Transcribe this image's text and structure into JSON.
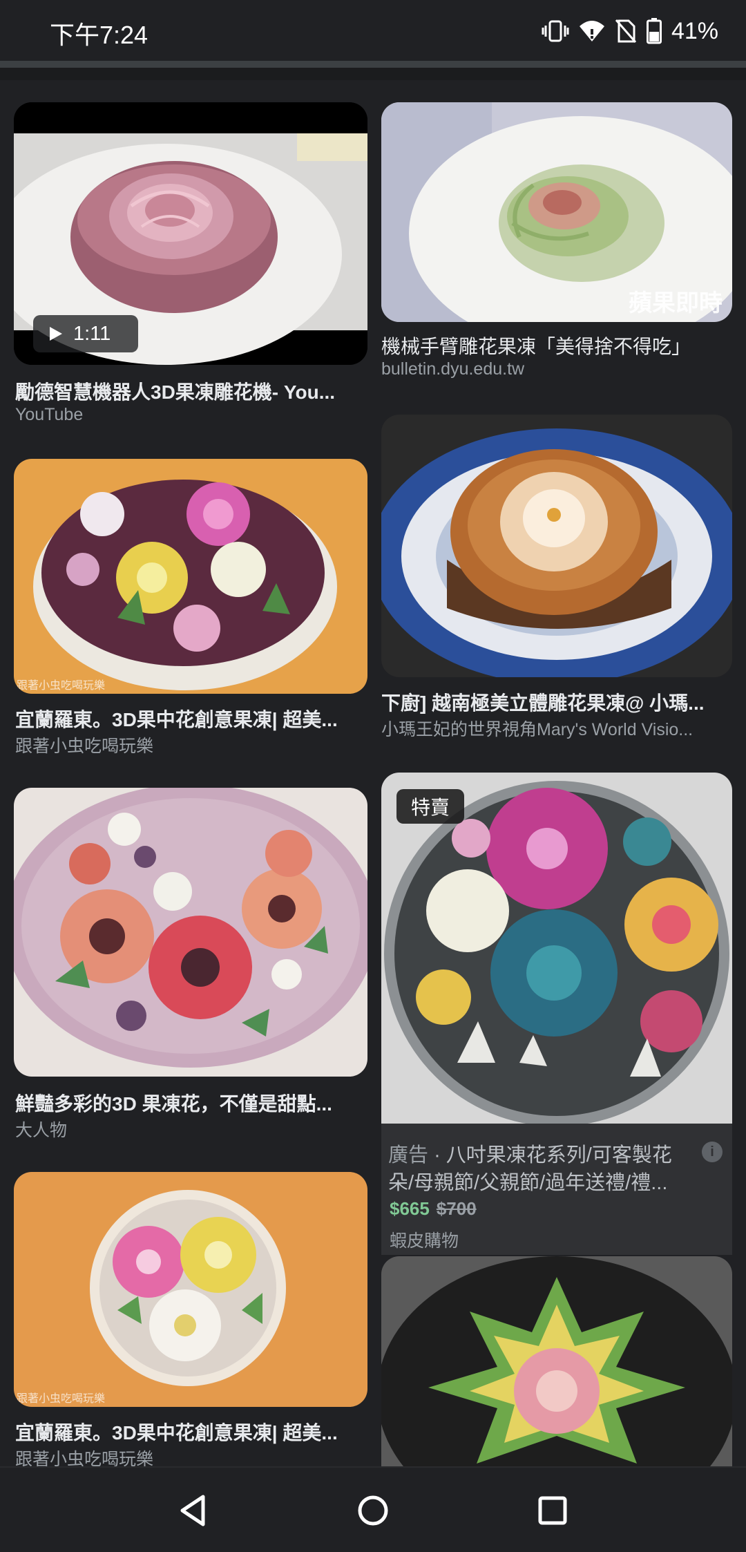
{
  "status_bar": {
    "time": "下午7:24",
    "battery": "41%"
  },
  "results": [
    {
      "title": "勵德智慧機器人3D果凍雕花機- You...",
      "source": "YouTube",
      "duration": "1:11",
      "thumb_icon": "pink-rose-jelly-image"
    },
    {
      "title": "機械手臂雕花果凍「美得捨不得吃」",
      "source": "bulletin.dyu.edu.tw",
      "watermark": "蘋果即時",
      "thumb_icon": "green-rose-jelly-image"
    },
    {
      "title": "宜蘭羅東。3D果中花創意果凍| 超美...",
      "source": "跟著小虫吃喝玩樂",
      "watermark": "跟著小虫吃喝玩樂",
      "thumb_icon": "flower-jelly-cake-image"
    },
    {
      "title": "下廚] 越南極美立體雕花果凍@ 小瑪...",
      "source": "小瑪王妃的世界視角Mary's World Visio...",
      "thumb_icon": "amber-flower-jelly-image"
    },
    {
      "title": "鮮豔多彩的3D 果凍花，不僅是甜點...",
      "source": "大人物",
      "thumb_icon": "peony-jelly-cake-image"
    },
    {
      "title": "宜蘭羅東。3D果中花創意果凍| 超美...",
      "source": "跟著小虫吃喝玩樂",
      "watermark": "跟著小虫吃喝玩樂",
      "thumb_icon": "peony-jelly-bowl-image"
    }
  ],
  "ad": {
    "badge": "特賣",
    "label": "廣告",
    "separator": " · ",
    "title_line1": "八吋果凍花系列/可客製花",
    "title_line2": "朵/母親節/父親節/過年送禮/禮...",
    "price": "$665",
    "original_price": "$700",
    "merchant": "蝦皮購物",
    "info": "i",
    "thumb_icon": "succulent-jelly-cake-image"
  },
  "partial_result": {
    "thumb_icon": "lotus-jelly-image"
  },
  "nav": {
    "back": "back-icon",
    "home": "home-icon",
    "recents": "recents-icon"
  },
  "colors": {
    "background": "#202124",
    "text_primary": "#e8eaed",
    "text_secondary": "#9aa0a6",
    "sale_price": "#81c995"
  }
}
